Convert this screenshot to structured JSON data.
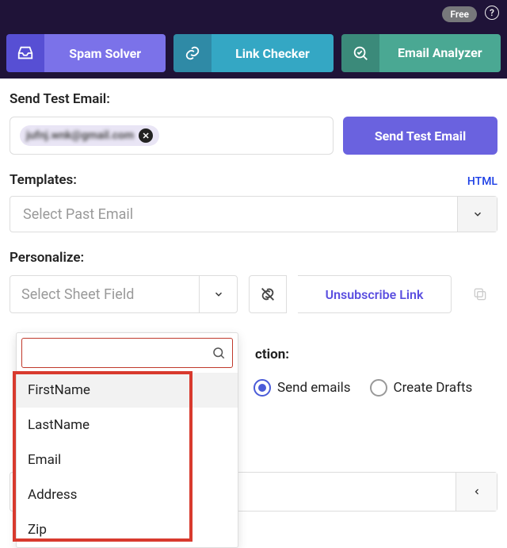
{
  "header": {
    "plan_badge": "Free",
    "help_glyph": "?",
    "tools": [
      {
        "key": "spam",
        "label": "Spam Solver",
        "icon": "inbox-icon"
      },
      {
        "key": "link",
        "label": "Link Checker",
        "icon": "link-icon"
      },
      {
        "key": "email",
        "label": "Email Analyzer",
        "icon": "analyze-icon"
      }
    ]
  },
  "send_test": {
    "label": "Send Test Email:",
    "chip_value": "jufnj.wnk@gmail.com",
    "button": "Send Test Email"
  },
  "templates": {
    "label": "Templates:",
    "html_link": "HTML",
    "placeholder": "Select Past Email"
  },
  "personalize": {
    "label": "Personalize:",
    "placeholder": "Select Sheet Field",
    "unsubscribe_label": "Unsubscribe Link",
    "search_value": "",
    "options": [
      "FirstName",
      "LastName",
      "Email",
      "Address",
      "Zip"
    ],
    "selected_index": 0
  },
  "action": {
    "label_suffix": "ction:",
    "options": {
      "send": "Send emails",
      "drafts": "Create Drafts"
    },
    "selected": "send"
  }
}
